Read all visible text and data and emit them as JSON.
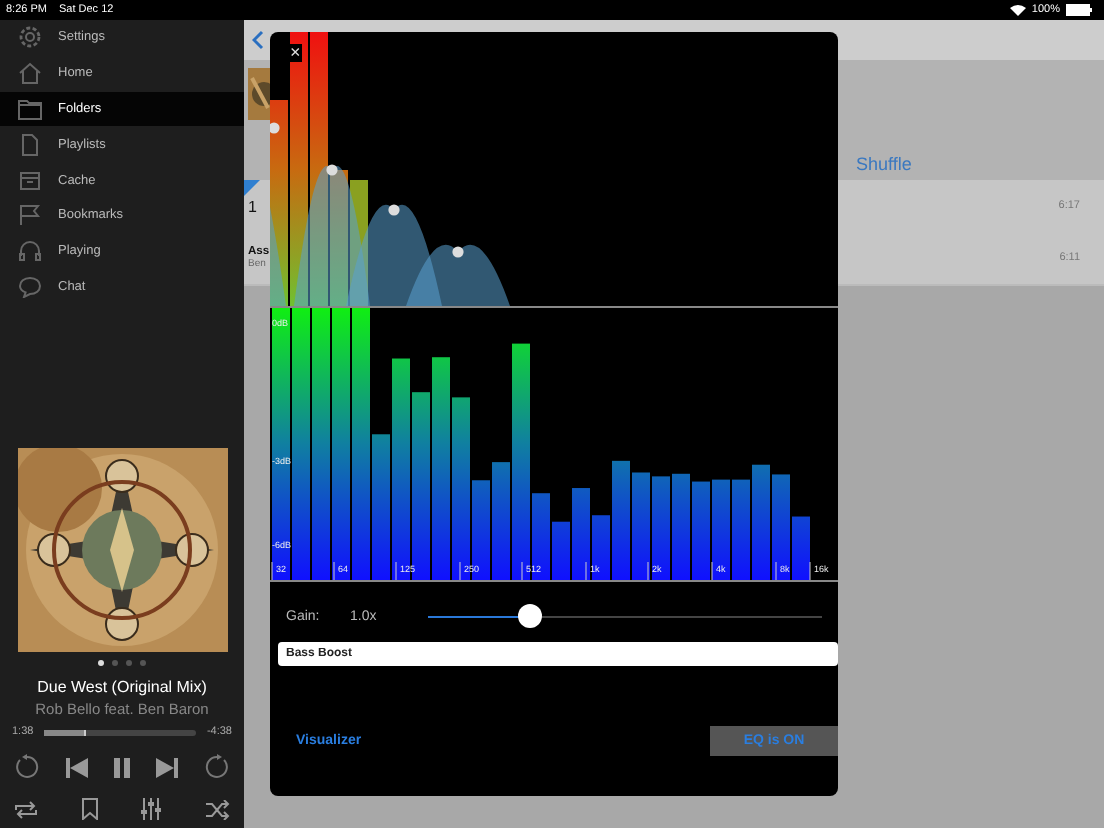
{
  "status_bar": {
    "time": "8:26 PM",
    "date": "Sat Dec 12",
    "battery": "100%"
  },
  "sidebar": {
    "items": [
      {
        "label": "Settings",
        "selected": false
      },
      {
        "label": "Home",
        "selected": false
      },
      {
        "label": "Folders",
        "selected": true
      },
      {
        "label": "Playlists",
        "selected": false
      },
      {
        "label": "Cache",
        "selected": false
      },
      {
        "label": "Bookmarks",
        "selected": false
      },
      {
        "label": "Playing",
        "selected": false
      },
      {
        "label": "Chat",
        "selected": false
      }
    ]
  },
  "now_playing": {
    "pages": [
      {
        "selected": true
      },
      {
        "selected": false
      },
      {
        "selected": false
      },
      {
        "selected": false
      }
    ],
    "title": "Due West (Original Mix)",
    "artist": "Rob Bello feat. Ben Baron",
    "elapsed": "1:38",
    "remaining": "-4:38",
    "level": 0.27
  },
  "background_list": {
    "shuffle": "Shuffle",
    "rows": [
      {
        "number": "1",
        "duration": "6:17"
      },
      {
        "title": "Ass",
        "subtitle": "Ben",
        "duration": "6:11"
      }
    ]
  },
  "equalizer": {
    "close": "×",
    "db_labels": [
      "0dB",
      "-3dB",
      "-6dB"
    ],
    "frequency_labels": [
      "32",
      "64",
      "125",
      "250",
      "512",
      "1k",
      "2k",
      "4k",
      "8k",
      "16k"
    ],
    "gain": {
      "label": "Gain:",
      "value": "1.0x",
      "level": 0.26
    },
    "preset": {
      "value": "Bass Boost"
    },
    "visualizer_link": "Visualizer",
    "eq_button": "EQ is ON"
  }
}
